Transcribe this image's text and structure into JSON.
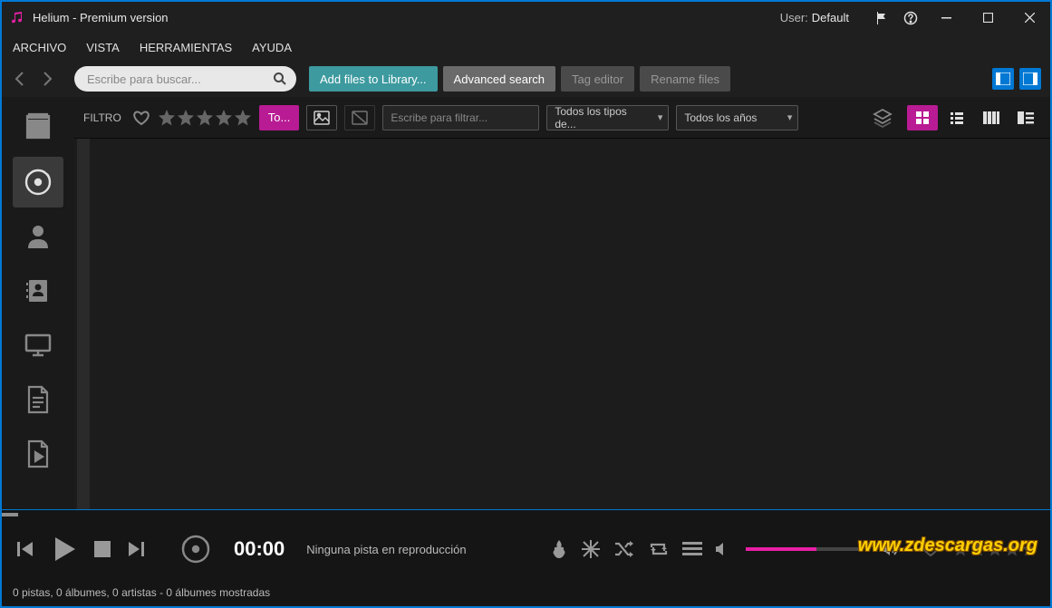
{
  "app": {
    "title": "Helium - Premium version"
  },
  "user": {
    "label": "User:",
    "name": "Default"
  },
  "menu": {
    "file": "ARCHIVO",
    "view": "VISTA",
    "tools": "HERRAMIENTAS",
    "help": "AYUDA"
  },
  "toolbar": {
    "search_placeholder": "Escribe para buscar...",
    "add_files": "Add files to Library...",
    "advanced": "Advanced search",
    "tag_editor": "Tag editor",
    "rename": "Rename files"
  },
  "filters": {
    "label": "FILTRO",
    "tag": "To...",
    "filter_placeholder": "Escribe para filtrar...",
    "type": "Todos los tipos de...",
    "year": "Todos los años"
  },
  "player": {
    "time": "00:00",
    "status": "Ninguna pista en reproducción"
  },
  "status": {
    "text": "0 pistas, 0 álbumes, 0 artistas - 0 álbumes mostradas"
  },
  "watermark": "www.zdescargas.org"
}
